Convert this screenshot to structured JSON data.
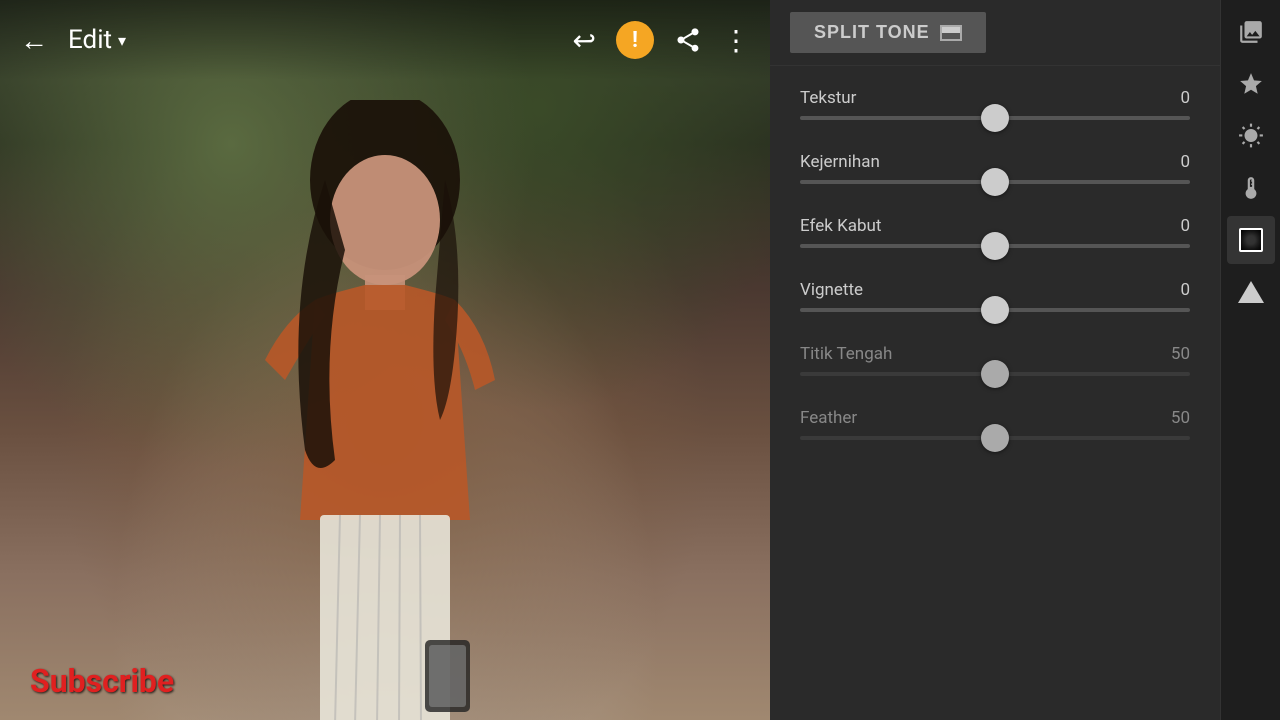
{
  "header": {
    "back_label": "←",
    "edit_label": "Edit",
    "edit_dropdown": "▾",
    "undo_label": "↩",
    "share_label": "⬆",
    "more_label": "⋮"
  },
  "split_tone": {
    "button_label": "SPLIT TONE"
  },
  "sliders": [
    {
      "id": "tekstur",
      "label": "Tekstur",
      "value": "0",
      "position": 50,
      "dimmed": false
    },
    {
      "id": "kejernihan",
      "label": "Kejernihan",
      "value": "0",
      "position": 50,
      "dimmed": false
    },
    {
      "id": "efek_kabut",
      "label": "Efek Kabut",
      "value": "0",
      "position": 50,
      "dimmed": false
    },
    {
      "id": "vignette",
      "label": "Vignette",
      "value": "0",
      "position": 50,
      "dimmed": false
    },
    {
      "id": "titik_tengah",
      "label": "Titik Tengah",
      "value": "50",
      "position": 50,
      "dimmed": true
    },
    {
      "id": "feather",
      "label": "Feather",
      "value": "50",
      "position": 50,
      "dimmed": true
    }
  ],
  "subscribe": {
    "label": "Subscribe"
  },
  "icons": [
    {
      "id": "gallery",
      "symbol": "🖼",
      "active": false
    },
    {
      "id": "enhance",
      "symbol": "✦",
      "active": false
    },
    {
      "id": "brightness",
      "symbol": "☀",
      "active": false
    },
    {
      "id": "temperature",
      "symbol": "🌡",
      "active": false
    },
    {
      "id": "vignette_icon",
      "symbol": "vignette",
      "active": true
    },
    {
      "id": "select_shape",
      "symbol": "▲",
      "active": false
    }
  ]
}
